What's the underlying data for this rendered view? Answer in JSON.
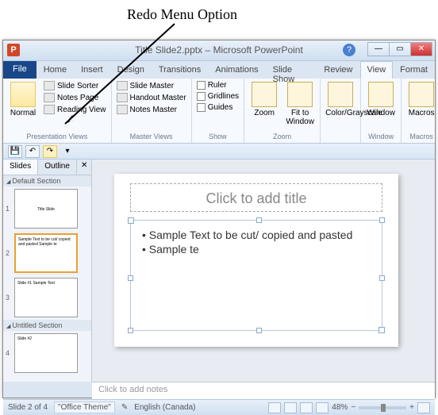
{
  "annotation": "Redo Menu Option",
  "window_title": "Title Slide2.pptx – Microsoft PowerPoint",
  "tabs": {
    "file": "File",
    "list": [
      "Home",
      "Insert",
      "Design",
      "Transitions",
      "Animations",
      "Slide Show",
      "Review",
      "View",
      "Format"
    ],
    "active": "View"
  },
  "ribbon": {
    "presentation_views": {
      "label": "Presentation Views",
      "normal": "Normal",
      "items": [
        "Slide Sorter",
        "Notes Page",
        "Reading View"
      ]
    },
    "master_views": {
      "label": "Master Views",
      "items": [
        "Slide Master",
        "Handout Master",
        "Notes Master"
      ]
    },
    "show": {
      "label": "Show",
      "items": [
        "Ruler",
        "Gridlines",
        "Guides"
      ]
    },
    "zoom": {
      "label": "Zoom",
      "zoom": "Zoom",
      "fit": "Fit to Window"
    },
    "color": {
      "label": "Color/Grayscale",
      "btn": "Color/Grayscale"
    },
    "window": {
      "label": "Window",
      "btn": "Window"
    },
    "macros": {
      "label": "Macros",
      "btn": "Macros"
    }
  },
  "pane_tabs": {
    "slides": "Slides",
    "outline": "Outline"
  },
  "sections": {
    "default": "Default Section",
    "untitled": "Untitled Section"
  },
  "thumbs": [
    {
      "n": "1",
      "text": "Title Slide"
    },
    {
      "n": "2",
      "text": "Sample Text to be cut/ copied and pasted  Sample te"
    },
    {
      "n": "3",
      "text": "Slide #1  Sample Text"
    },
    {
      "n": "4",
      "text": "Slide #2"
    }
  ],
  "slide": {
    "title_placeholder": "Click to add title",
    "bullets": [
      "Sample Text to be cut/ copied and pasted",
      "Sample te"
    ]
  },
  "notes_placeholder": "Click to add notes",
  "status": {
    "slide": "Slide 2 of 4",
    "theme": "\"Office Theme\"",
    "lang": "English (Canada)",
    "zoom": "48%"
  }
}
